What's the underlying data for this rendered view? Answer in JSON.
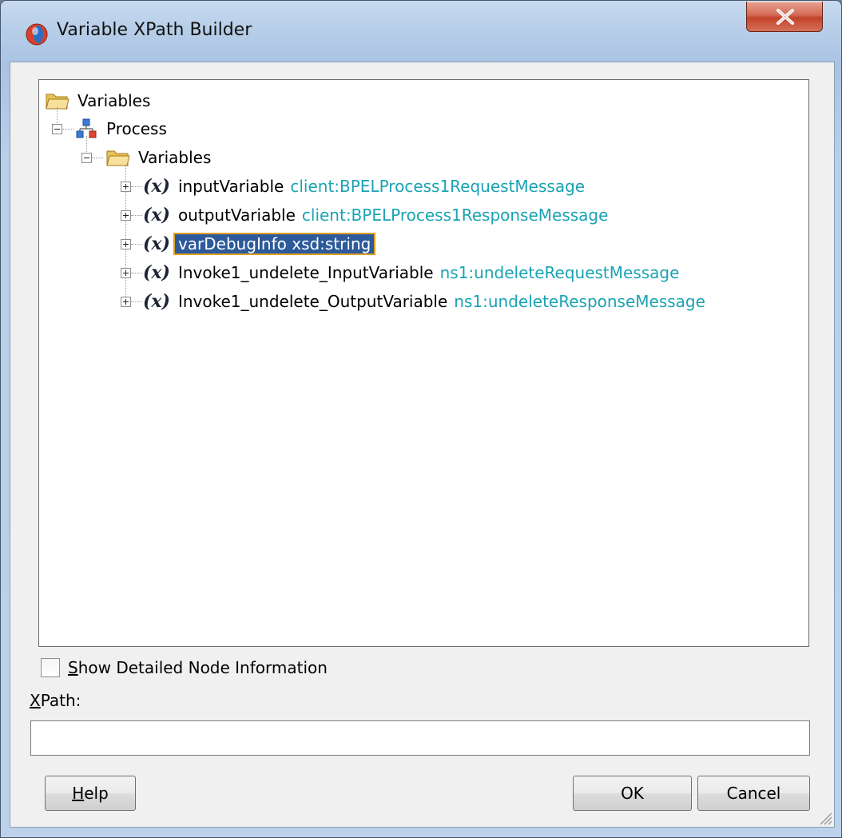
{
  "window": {
    "title": "Variable XPath Builder",
    "close_symbol": "X"
  },
  "tree": {
    "root_label": "Variables",
    "process_label": "Process",
    "variables_label": "Variables",
    "items": [
      {
        "name": "inputVariable",
        "type": "client:BPELProcess1RequestMessage"
      },
      {
        "name": "outputVariable",
        "type": "client:BPELProcess1ResponseMessage"
      },
      {
        "name": "varDebugInfo",
        "type": "xsd:string",
        "selected": true
      },
      {
        "name": "Invoke1_undelete_InputVariable",
        "type": "ns1:undeleteRequestMessage"
      },
      {
        "name": "Invoke1_undelete_OutputVariable",
        "type": "ns1:undeleteResponseMessage"
      }
    ],
    "var_icon_text": "(x)"
  },
  "options": {
    "detail_checkbox_label_first": "S",
    "detail_checkbox_label_rest": "how Detailed Node Information",
    "detail_checked": false
  },
  "xpath": {
    "label_first": "X",
    "label_rest": "Path:",
    "value": ""
  },
  "buttons": {
    "help_first": "H",
    "help_rest": "elp",
    "ok": "OK",
    "cancel": "Cancel"
  },
  "colors": {
    "type_text": "#1aa3b3",
    "selection_bg": "#2c5a9a",
    "selection_outline": "#e0a226",
    "close_button": "#c2432a"
  }
}
